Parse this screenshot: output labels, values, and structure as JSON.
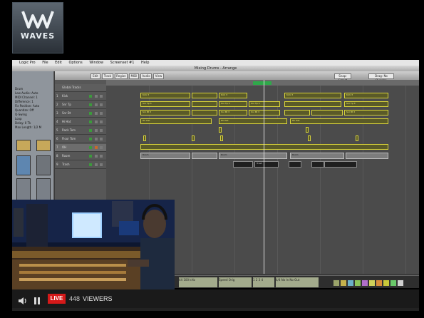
{
  "logo": {
    "text": "WAVES"
  },
  "menubar": {
    "items": [
      "Logic Pro",
      "File",
      "Edit",
      "Options",
      "Window",
      "Screenset #1",
      "Help"
    ]
  },
  "window": {
    "title": "Mixing Drums - Arrange"
  },
  "toolbar": {
    "buttons": [
      "Edit",
      "Track",
      "Region",
      "MIDI",
      "Audio",
      "View"
    ],
    "right_buttons": [
      "Snap: Smart",
      "Drag: No Overlap"
    ]
  },
  "inspector": {
    "rows": [
      "Drum",
      "Low Audio: Auto",
      "MIDI Channel: 1",
      "Difference: 1",
      "Fix Position: Auto",
      "Quantize: Off",
      "Q-Swing",
      "Loop",
      "Delay: 0 Tk",
      "Max Length: 1/2 M"
    ]
  },
  "global_tracks_label": "Global Tracks",
  "tracks": [
    {
      "num": "1",
      "name": "Kick"
    },
    {
      "num": "2",
      "name": "Snr Tp"
    },
    {
      "num": "3",
      "name": "Snr Bt"
    },
    {
      "num": "4",
      "name": "Hi Hat"
    },
    {
      "num": "5",
      "name": "Rack Tom"
    },
    {
      "num": "6",
      "name": "Floor Tom"
    },
    {
      "num": "7",
      "name": "OH"
    },
    {
      "num": "8",
      "name": "Room"
    },
    {
      "num": "9",
      "name": "Trash"
    }
  ],
  "regions": [
    {
      "label": "Kick 3"
    },
    {
      "label": "Kick 3"
    },
    {
      "label": "Kick 3"
    },
    {
      "label": "Kick 3"
    },
    {
      "label": "Snr Tp 3"
    },
    {
      "label": "Snr Tp 3"
    },
    {
      "label": "Snr Tp 3"
    },
    {
      "label": "Snr Tp 3"
    },
    {
      "label": "Snr Bt 3"
    },
    {
      "label": "Snr Bt 3"
    },
    {
      "label": "Snr Bt 3"
    },
    {
      "label": "Snr Bt 3"
    },
    {
      "label": "Hh Hat"
    },
    {
      "label": "Hh Hat"
    },
    {
      "label": "Hh Hat"
    },
    {
      "label": "Room"
    },
    {
      "label": "Room"
    },
    {
      "label": "Room"
    },
    {
      "label": "Trash"
    }
  ],
  "transport": {
    "lcd1": "44 100 kHz",
    "lcd2": "Speed Orig",
    "lcd3": "1 2 3 4",
    "lcd4": "4/4  No In  No Out"
  },
  "colors": {
    "region_border": "#d7d23a",
    "live": "#d51919",
    "playhead": "#dcdcdc"
  },
  "player": {
    "live_label": "LIVE",
    "viewer_count": "448",
    "viewers_label": "VIEWERS",
    "speaker_icon": "speaker-icon",
    "pause_icon": "pause-icon"
  }
}
